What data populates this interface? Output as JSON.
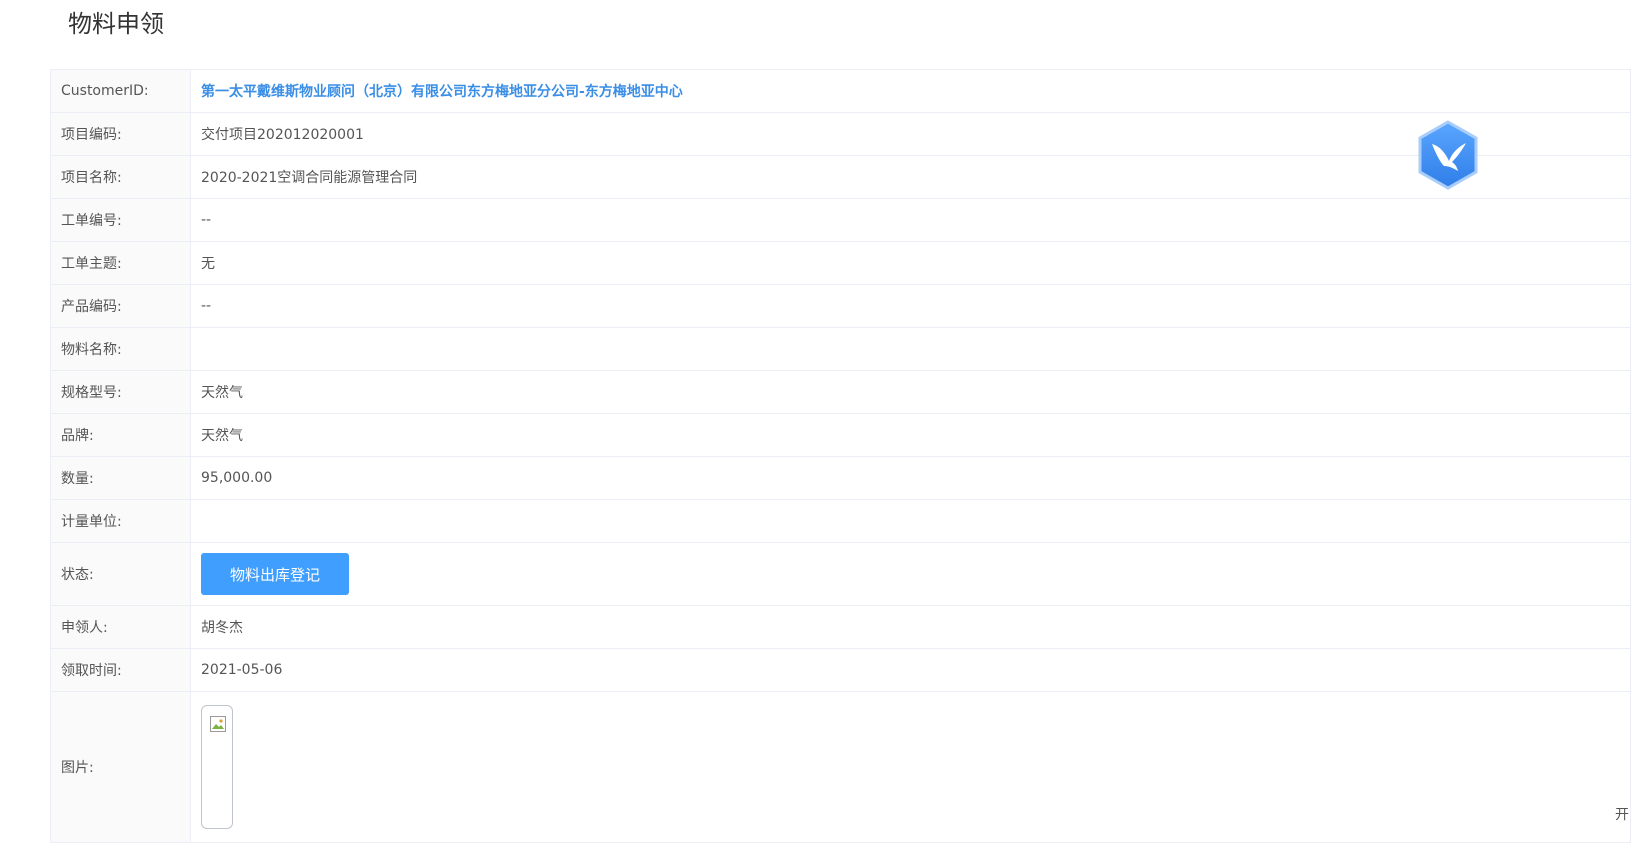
{
  "page": {
    "title": "物料申领"
  },
  "fields": {
    "customer_id": {
      "label": "CustomerID:",
      "value": "第一太平戴维斯物业顾问（北京）有限公司东方梅地亚分公司-东方梅地亚中心"
    },
    "project_code": {
      "label": "项目编码:",
      "value": "交付项目202012020001"
    },
    "project_name": {
      "label": "项目名称:",
      "value": "2020-2021空调合同能源管理合同"
    },
    "work_order_no": {
      "label": "工单编号:",
      "value": "--"
    },
    "work_order_subject": {
      "label": "工单主题:",
      "value": "无"
    },
    "product_code": {
      "label": "产品编码:",
      "value": "--"
    },
    "material_name": {
      "label": "物料名称:",
      "value": ""
    },
    "spec_model": {
      "label": "规格型号:",
      "value": "天然气"
    },
    "brand": {
      "label": "品牌:",
      "value": "天然气"
    },
    "quantity": {
      "label": "数量:",
      "value": "95,000.00"
    },
    "unit": {
      "label": "计量单位:",
      "value": ""
    },
    "status": {
      "label": "状态:",
      "button_label": "物料出库登记"
    },
    "applicant": {
      "label": "申领人:",
      "value": "胡冬杰"
    },
    "receive_time": {
      "label": "领取时间:",
      "value": "2021-05-06"
    },
    "image": {
      "label": "图片:"
    }
  },
  "overlay": {
    "logo_icon": "hummingbird-hexagon-icon",
    "corner_text": "开"
  },
  "colors": {
    "link": "#3a8ee6",
    "button_bg": "#409eff",
    "logo": "#3d8ef0"
  }
}
